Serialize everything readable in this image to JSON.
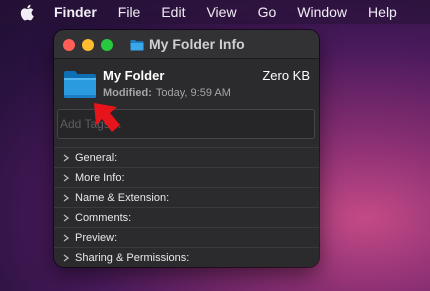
{
  "menubar": {
    "app_name": "Finder",
    "items": [
      "File",
      "Edit",
      "View",
      "Go",
      "Window",
      "Help"
    ]
  },
  "window": {
    "title": "My Folder Info",
    "folder_name": "My Folder",
    "size": "Zero KB",
    "modified_label": "Modified:",
    "modified_value": "Today, 9:59 AM",
    "tags_placeholder": "Add Tags…",
    "sections": [
      "General:",
      "More Info:",
      "Name & Extension:",
      "Comments:",
      "Preview:",
      "Sharing & Permissions:"
    ]
  },
  "colors": {
    "folder_blue": "#1e8fd8",
    "arrow_red": "#e8141b",
    "close": "#ff5f57",
    "minimize": "#febc2e",
    "zoom": "#28c840"
  }
}
